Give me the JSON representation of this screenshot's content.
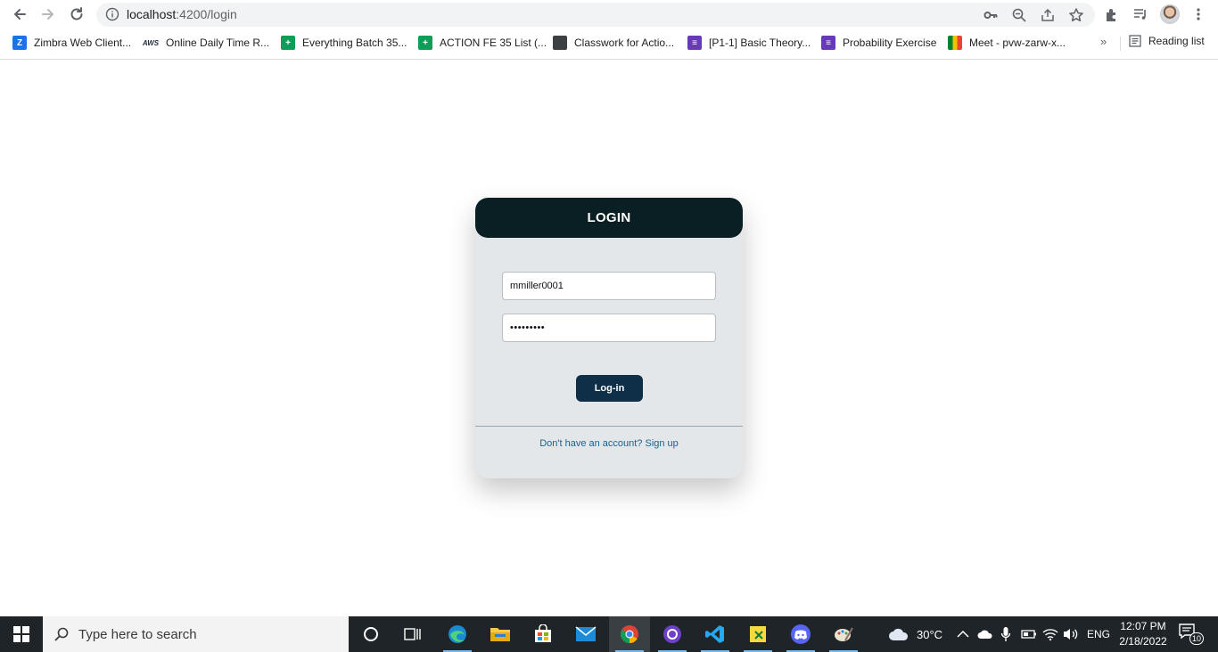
{
  "browser": {
    "url_host": "localhost",
    "url_path": ":4200/login",
    "bookmarks": [
      {
        "label": "Zimbra Web Client...",
        "icon": "zimbra-icon",
        "glyph": "Z"
      },
      {
        "label": "Online Daily Time R...",
        "icon": "aws-icon",
        "glyph": "AWS"
      },
      {
        "label": "Everything Batch 35...",
        "icon": "sheets-icon",
        "glyph": "+"
      },
      {
        "label": "ACTION FE 35 List (...",
        "icon": "sheets-icon",
        "glyph": "+"
      },
      {
        "label": "Classwork for Actio...",
        "icon": "classroom-icon",
        "glyph": ""
      },
      {
        "label": "[P1-1] Basic Theory...",
        "icon": "forms-icon",
        "glyph": "≡"
      },
      {
        "label": "Probability Exercise",
        "icon": "forms-icon",
        "glyph": "≡"
      },
      {
        "label": "Meet - pvw-zarw-x...",
        "icon": "meet-icon",
        "glyph": ""
      }
    ],
    "more_bookmarks": "»",
    "reading_list": "Reading list"
  },
  "login": {
    "title": "LOGIN",
    "username_value": "mmiller0001",
    "password_value": "•••••••••",
    "submit_label": "Log-in",
    "signup_text": "Don't have an account? Sign up"
  },
  "taskbar": {
    "search_placeholder": "Type here to search",
    "weather": "30°C",
    "language": "ENG",
    "time": "12:07 PM",
    "date": "2/18/2022",
    "notification_count": "10",
    "colors": {
      "bar": "#1f2428",
      "active_underline": "#76b9ed"
    }
  },
  "colors": {
    "card_background": "#e3e7ea",
    "card_header": "#0a1f24",
    "button": "#0e2f47",
    "link": "#1d5f8a"
  }
}
